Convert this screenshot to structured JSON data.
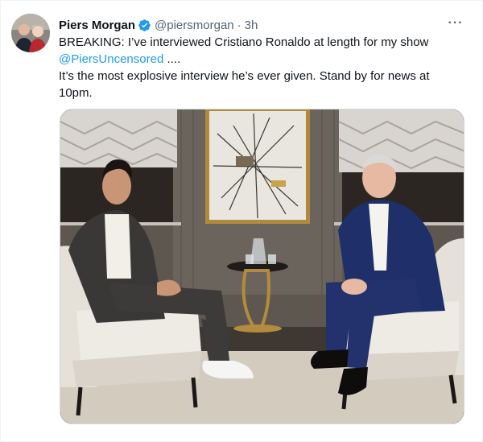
{
  "tweet": {
    "author_name": "Piers Morgan",
    "handle": "@piersmorgan",
    "separator": "·",
    "time": "3h",
    "more_label": "···",
    "text_line1": "BREAKING: I’ve interviewed Cristiano Ronaldo at length for my show",
    "mention": "@PiersUncensored",
    "mention_suffix": " ....",
    "text_line2": "It’s the most explosive interview he’s ever given. Stand by for news at",
    "text_line3": "10pm."
  },
  "icons": {
    "verified": "verified-badge-icon",
    "more": "more-options-icon"
  },
  "colors": {
    "link": "#1d9bf0",
    "verified": "#1d9bf0",
    "secondary_text": "#536471",
    "primary_text": "#0f1419"
  }
}
